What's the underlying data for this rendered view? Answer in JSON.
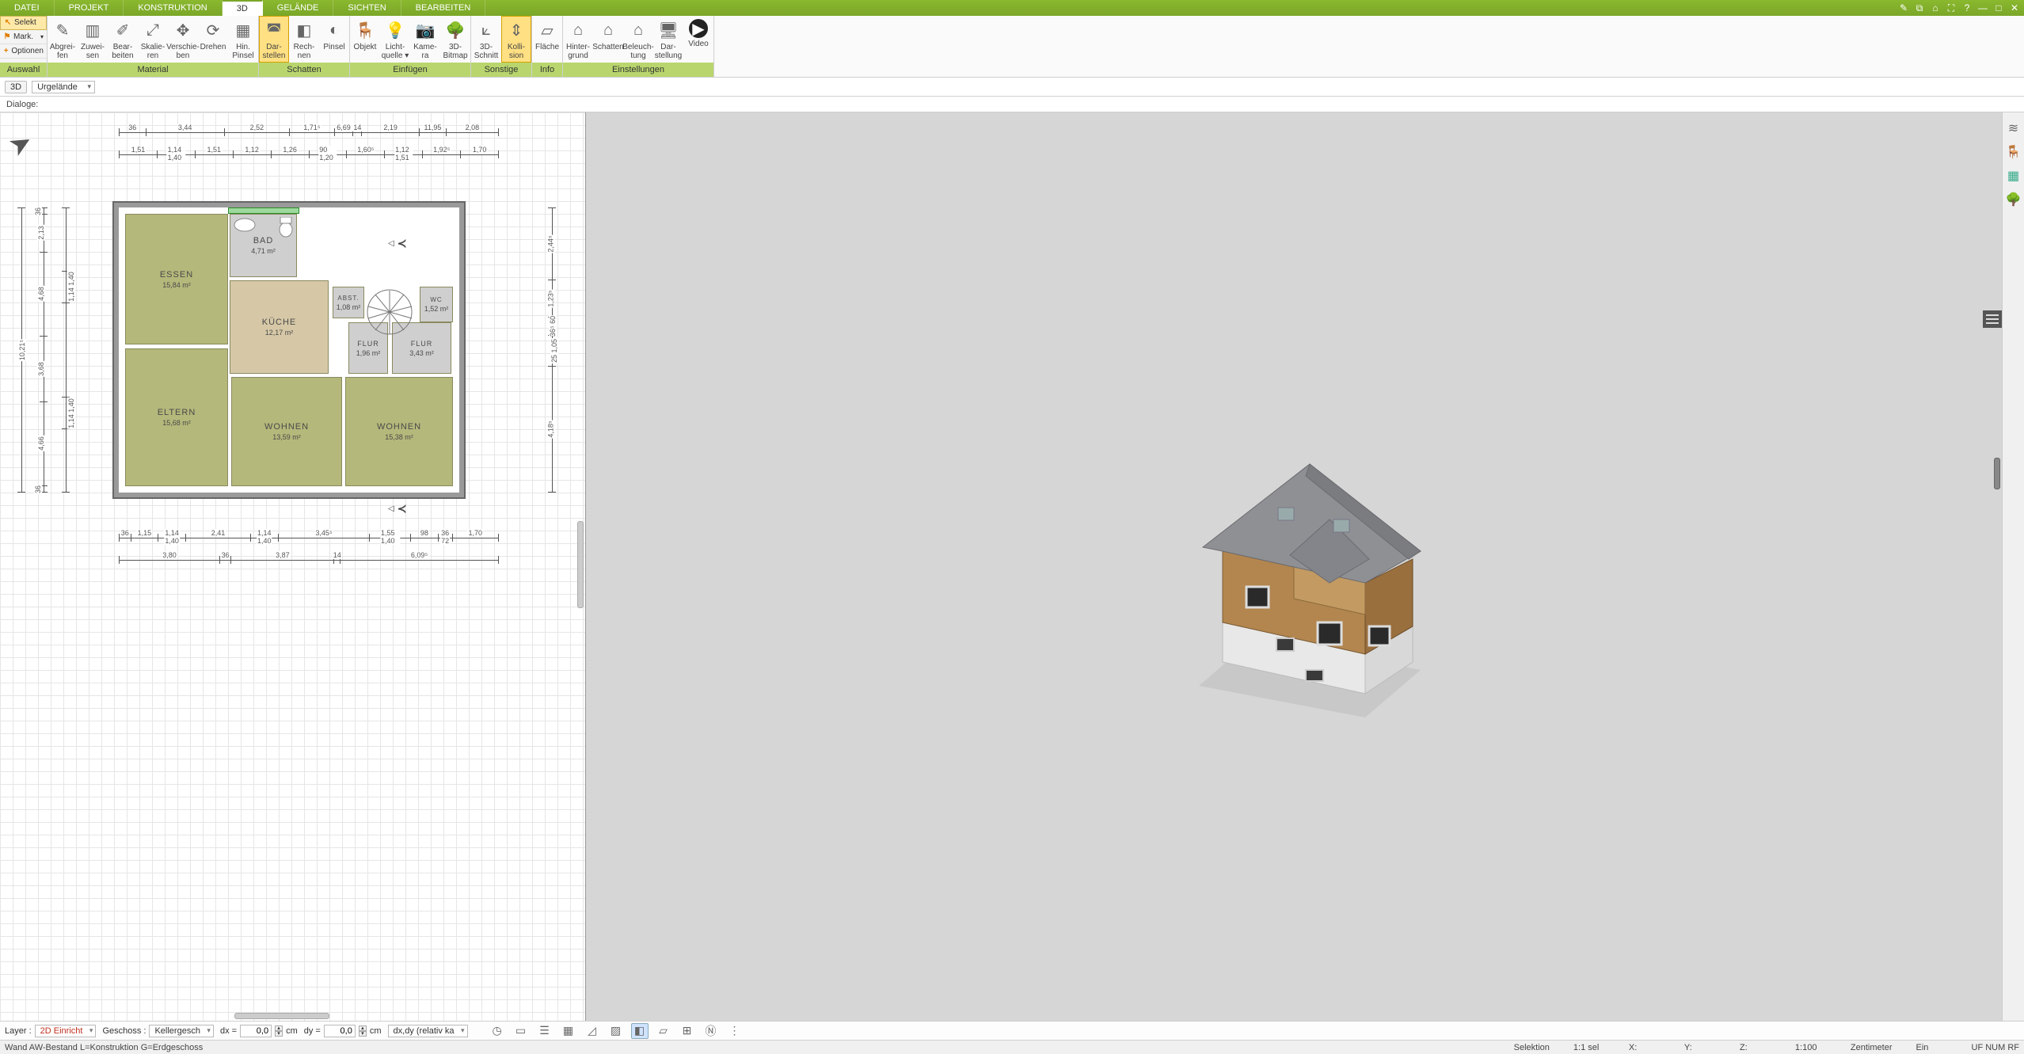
{
  "menu": {
    "items": [
      "DATEI",
      "PROJEKT",
      "KONSTRUKTION",
      "3D",
      "GELÄNDE",
      "SICHTEN",
      "BEARBEITEN"
    ],
    "active_index": 3
  },
  "sys_icons": [
    "✎",
    "⧉",
    "⌂",
    "⛶",
    "?",
    "—",
    "□",
    "✕"
  ],
  "ribbon_left": {
    "selekt": "Selekt",
    "mark": "Mark.",
    "optionen": "Optionen",
    "group": "Auswahl"
  },
  "ribbon_groups": [
    {
      "title": "Material",
      "buttons": [
        {
          "id": "abgreifen",
          "label": "Abgrei-\nfen",
          "glyph": "✎"
        },
        {
          "id": "zuweisen",
          "label": "Zuwei-\nsen",
          "glyph": "▥"
        },
        {
          "id": "bearbeiten",
          "label": "Bear-\nbeiten",
          "glyph": "✐"
        },
        {
          "id": "skalieren",
          "label": "Skalie-\nren",
          "glyph": "⤢"
        },
        {
          "id": "verschieben",
          "label": "Verschie-\nben",
          "glyph": "✥"
        },
        {
          "id": "drehen",
          "label": "Drehen",
          "glyph": "⟳"
        },
        {
          "id": "hinpinsel",
          "label": "Hin.\nPinsel",
          "glyph": "▦"
        }
      ]
    },
    {
      "title": "Schatten",
      "buttons": [
        {
          "id": "darstellen",
          "label": "Dar-\nstellen",
          "glyph": "◚",
          "active": true
        },
        {
          "id": "rechnen",
          "label": "Rech-\nnen",
          "glyph": "◧"
        },
        {
          "id": "pinsel",
          "label": "Pinsel",
          "glyph": "◐"
        }
      ]
    },
    {
      "title": "Einfügen",
      "buttons": [
        {
          "id": "objekt",
          "label": "Objekt",
          "glyph": "🪑"
        },
        {
          "id": "lichtquelle",
          "label": "Licht-\nquelle ▾",
          "glyph": "💡"
        },
        {
          "id": "kamera",
          "label": "Kame-\nra",
          "glyph": "📷"
        },
        {
          "id": "3dbitmap",
          "label": "3D-\nBitmap",
          "glyph": "🌳"
        }
      ]
    },
    {
      "title": "Sonstige",
      "buttons": [
        {
          "id": "3dschnitt",
          "label": "3D-\nSchnitt",
          "glyph": "⟀"
        },
        {
          "id": "kollision",
          "label": "Kolli-\nsion",
          "glyph": "⇕",
          "active": true
        }
      ]
    },
    {
      "title": "Info",
      "buttons": [
        {
          "id": "flaeche",
          "label": "Fläche",
          "glyph": "▱"
        }
      ]
    },
    {
      "title": "Einstellungen",
      "buttons": [
        {
          "id": "hintergrund",
          "label": "Hinter-\ngrund",
          "glyph": "⌂"
        },
        {
          "id": "schatten2",
          "label": "Schatten",
          "glyph": "⌂"
        },
        {
          "id": "beleuchtung",
          "label": "Beleuch-\ntung",
          "glyph": "⌂"
        },
        {
          "id": "darstellung",
          "label": "Dar-\nstellung",
          "glyph": "🖥"
        },
        {
          "id": "video",
          "label": "Video",
          "glyph": "▶"
        }
      ]
    }
  ],
  "subbar": {
    "mode": "3D",
    "view": "Urgelände"
  },
  "dialogbar": {
    "label": "Dialoge:"
  },
  "plan": {
    "rooms": {
      "essen": {
        "name": "ESSEN",
        "area": "15,84 m²"
      },
      "bad": {
        "name": "BAD",
        "area": "4,71 m²"
      },
      "abst": {
        "name": "ABST.",
        "area": "1,08 m²"
      },
      "kueche": {
        "name": "KÜCHE",
        "area": "12,17 m²"
      },
      "wc": {
        "name": "WC",
        "area": "1,52 m²"
      },
      "flur1": {
        "name": "FLUR",
        "area": "1,96 m²"
      },
      "flur2": {
        "name": "FLUR",
        "area": "3,43 m²"
      },
      "eltern": {
        "name": "ELTERN",
        "area": "15,68 m²"
      },
      "wohnen1": {
        "name": "WOHNEN",
        "area": "13,59 m²"
      },
      "wohnen2": {
        "name": "WOHNEN",
        "area": "15,38 m²"
      }
    },
    "dims_top1": [
      "36",
      "3,44",
      "2,52",
      "1,71⁵",
      "6,69",
      "14",
      "2,19",
      "11,95",
      "2,08"
    ],
    "dims_top2": [
      "1,51",
      "1,14\n1,40",
      "1,51",
      "1,12",
      "1,26",
      "90\n1,20",
      "1,60⁵",
      "1,12\n1,51",
      "1,92⁵",
      "1,70"
    ],
    "dims_bot1": [
      "36",
      "1,15",
      "1,14\n1,40",
      "2,41",
      "1,14\n1,40",
      "3,45⁵",
      "1,55\n1,40",
      "98",
      "36\n72",
      "1,70"
    ],
    "dims_bot2": [
      "3,80",
      "36",
      "3,87",
      "14",
      "6,09⁵"
    ],
    "dims_left": [
      "36",
      "2,13",
      "4,68",
      "1,14\n1,40",
      "10,21⁵",
      "3,68",
      "4,66",
      "1,14\n1,40",
      "36"
    ],
    "dims_right": [
      "2,44⁵",
      "1,23⁵",
      "36⁵\n60",
      "25\n1,05",
      "4,18⁵"
    ]
  },
  "right_tools": [
    "≋",
    "🪑",
    "▦",
    "🌳"
  ],
  "bottombar": {
    "layer_label": "Layer :",
    "layer_value": "2D Einricht",
    "geschoss_label": "Geschoss :",
    "geschoss_value": "Kellergesch",
    "dx_label": "dx =",
    "dx_value": "0,0",
    "dx_unit": "cm",
    "dy_label": "dy =",
    "dy_value": "0,0",
    "dy_unit": "cm",
    "mode": "dx,dy (relativ ka",
    "icons": [
      "◷",
      "▭",
      "☰",
      "▦",
      "◿",
      "▨",
      "◧",
      "▱",
      "⊞",
      "Ⓝ",
      "⋮"
    ],
    "icons_on": [
      6
    ]
  },
  "statusbar": {
    "left": "Wand AW-Bestand L=Konstruktion G=Erdgeschoss",
    "selektion": "Selektion",
    "sel_count": "1:1 sel",
    "x_label": "X:",
    "y_label": "Y:",
    "z_label": "Z:",
    "scale": "1:100",
    "unit": "Zentimeter",
    "ein": "Ein",
    "flags": "UF NUM RF"
  }
}
